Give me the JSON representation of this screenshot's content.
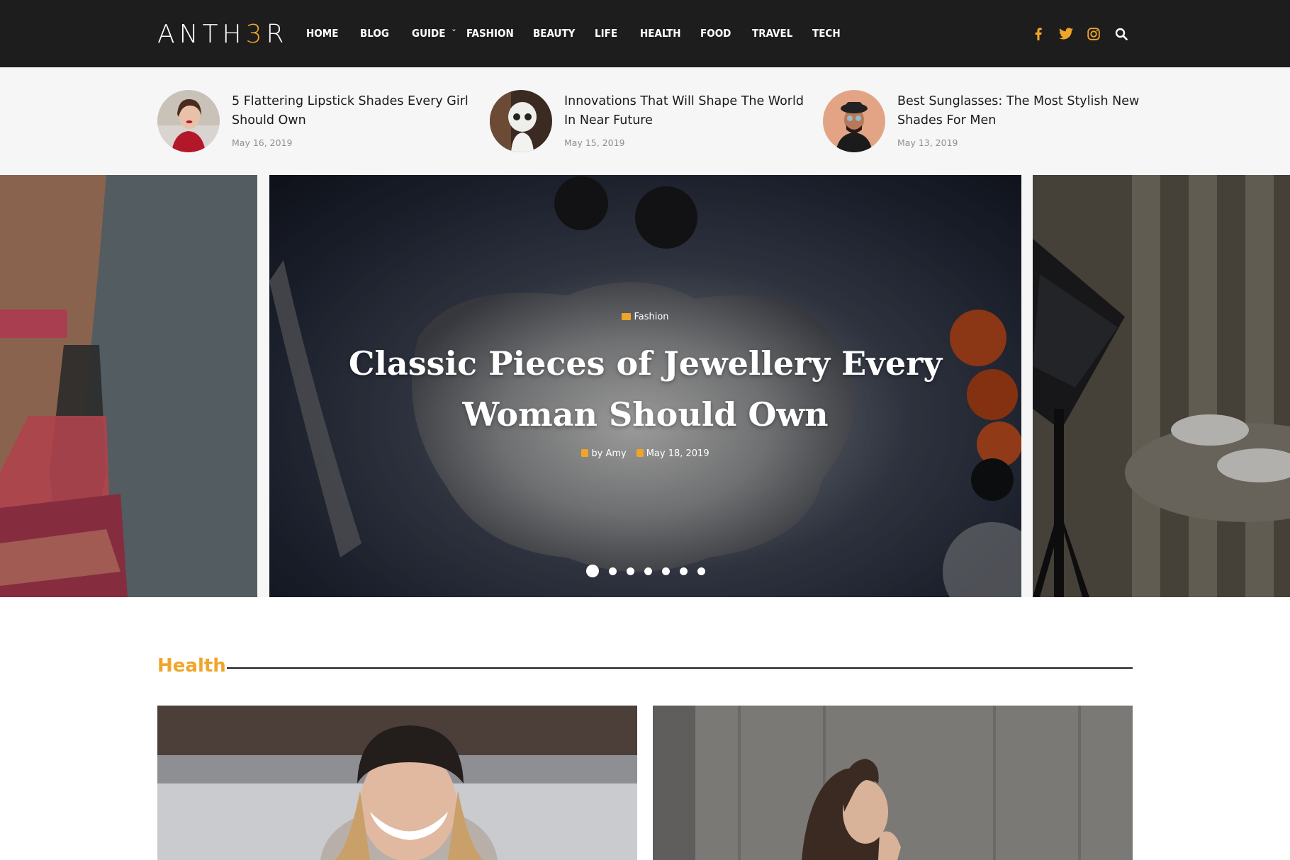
{
  "header": {
    "logo_text": "ANTH",
    "logo_accent": "3",
    "logo_tail": "R",
    "nav": [
      "HOME",
      "BLOG",
      "GUIDE",
      "FASHION",
      "BEAUTY",
      "LIFE",
      "HEALTH",
      "FOOD",
      "TRAVEL",
      "TECH"
    ],
    "social_icons": [
      "facebook-icon",
      "twitter-icon",
      "instagram-icon",
      "search-icon"
    ]
  },
  "featured": [
    {
      "title": "5 Flattering Lipstick Shades Every Girl Should Own",
      "date": "May 16, 2019"
    },
    {
      "title": "Innovations That Will Shape The World In Near Future",
      "date": "May 15, 2019"
    },
    {
      "title": "Best Sunglasses: The Most Stylish New Shades For Men",
      "date": "May 13, 2019"
    }
  ],
  "slider": {
    "category": "Fashion",
    "title": "Classic Pieces of Jewellery Every Woman Should Own",
    "author": "by Amy",
    "date": "May 18, 2019",
    "dot_count": 7,
    "active_dot": 1
  },
  "section": {
    "title": "Health"
  },
  "colors": {
    "accent": "#f0a52a",
    "header_bg": "#1d1d1d",
    "strip_bg": "#f6f6f6"
  }
}
